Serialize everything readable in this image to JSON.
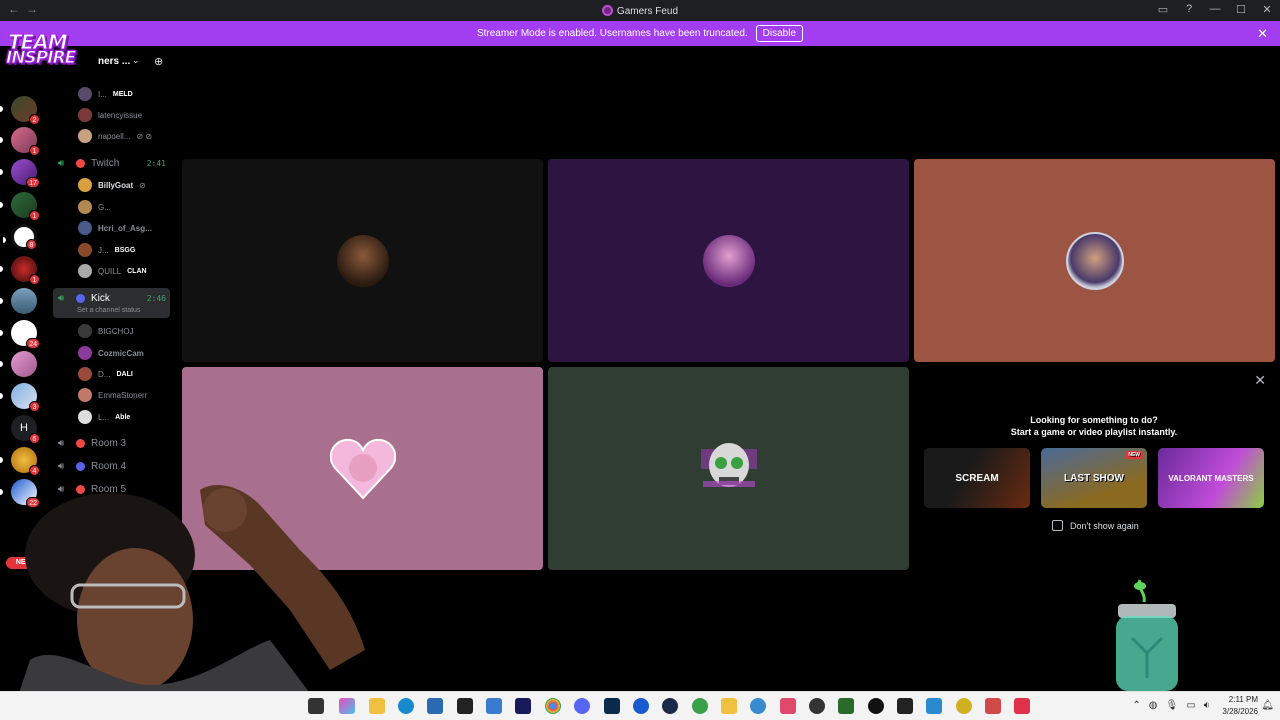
{
  "window": {
    "title": "Gamers Feud",
    "nav_back": "←",
    "nav_forward": "→",
    "icons": [
      "inbox-icon",
      "help-icon",
      "minimize-icon",
      "maximize-icon",
      "close-icon"
    ]
  },
  "banner": {
    "message": "Streamer Mode is enabled. Usernames have been truncated.",
    "button": "Disable",
    "close": "✕"
  },
  "server_rail": {
    "badges": [
      "2",
      "1",
      "17",
      "1",
      "8",
      "1",
      "24",
      "3",
      "6",
      "4",
      "22"
    ],
    "letter_server": "H",
    "new_label": "NEW"
  },
  "overlay_logo": {
    "line1": "TEAM",
    "line2": "INSPIRE"
  },
  "sidebar": {
    "server_name": "ners ...",
    "members_top": [
      {
        "name": "I...",
        "tag": "MELD"
      },
      {
        "name": "latencyissue",
        "tag": ""
      },
      {
        "name": "napoell...",
        "tag": ""
      }
    ],
    "channels": [
      {
        "name": "Twitch",
        "time": "2:41",
        "color": "#f04747"
      },
      {
        "name": "Kick",
        "time": "2:46",
        "color": "#5865f2",
        "status": "Set a channel status"
      },
      {
        "name": "Room 3",
        "color": "#f04747"
      },
      {
        "name": "Room 4",
        "color": "#5865f2"
      },
      {
        "name": "Room 5",
        "color": "#f04747"
      }
    ],
    "twitch_members": [
      {
        "name": "BillyGoat",
        "tag": ""
      },
      {
        "name": "G...",
        "tag": ""
      },
      {
        "name": "Hcri_of_Asg...",
        "tag": ""
      },
      {
        "name": "J...",
        "tag": "BSGG"
      },
      {
        "name": "QUILL",
        "tag": "CLAN"
      }
    ],
    "kick_members": [
      {
        "name": "BIGCHOJ",
        "tag": ""
      },
      {
        "name": "CozmicCam",
        "tag": ""
      },
      {
        "name": "D...",
        "tag": "DALI"
      },
      {
        "name": "EmmaStonerr",
        "tag": ""
      },
      {
        "name": "L...",
        "tag": "Able"
      }
    ]
  },
  "tiles": [
    {
      "bg": "#111111"
    },
    {
      "bg": "#2e1440"
    },
    {
      "bg": "#9c5443"
    },
    {
      "bg": "#a96f8f"
    },
    {
      "bg": "#2f3d33"
    }
  ],
  "activity": {
    "close": "✕",
    "line1": "Looking for something to do?",
    "line2": "Start a game or video playlist instantly.",
    "games": [
      {
        "title": "SCREAM",
        "badge": ""
      },
      {
        "title": "LAST SHOW",
        "badge": "NEW"
      },
      {
        "title": "VALORANT MASTERS",
        "badge": ""
      }
    ],
    "dont_show": "Don't show again"
  },
  "taskbar": {
    "time": "2:11 PM",
    "date": "3/28/2026"
  }
}
